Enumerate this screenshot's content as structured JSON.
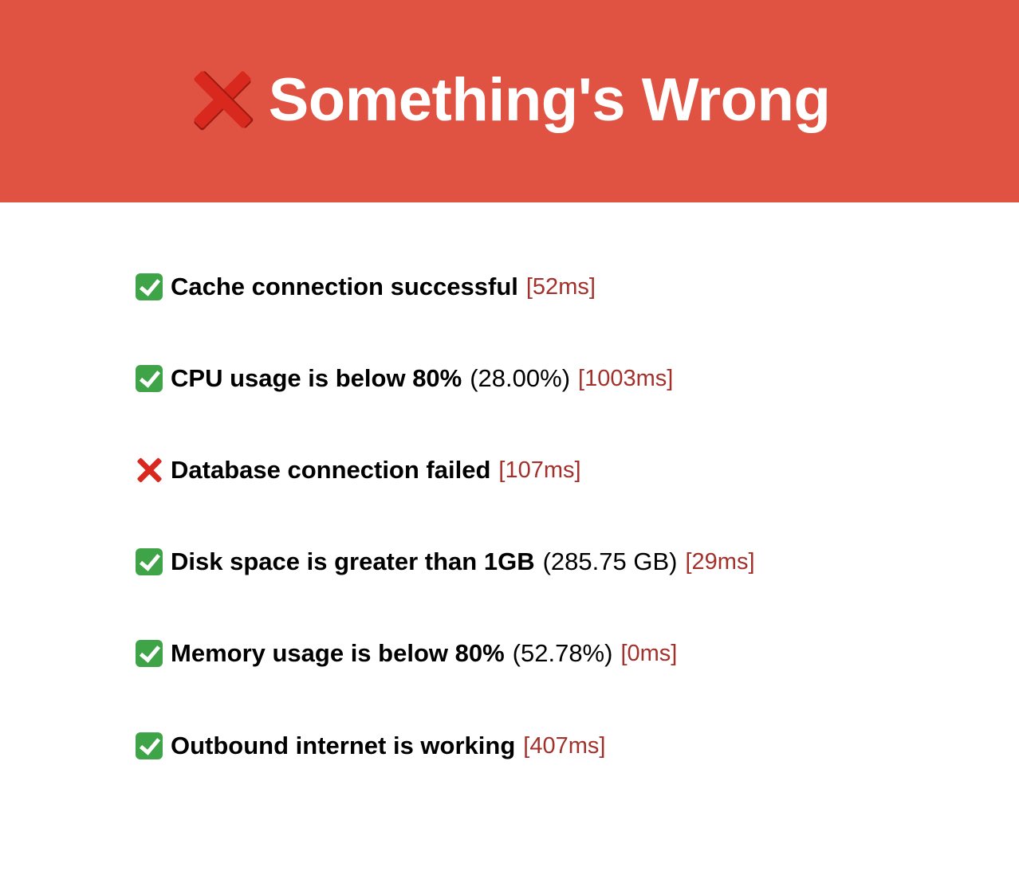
{
  "header": {
    "status_icon": "cross-mark-icon",
    "title": "Something's Wrong",
    "background_color": "#e05343"
  },
  "checks": [
    {
      "status": "pass",
      "icon": "check-mark-icon",
      "label": "Cache connection successful",
      "detail": "",
      "time": "[52ms]"
    },
    {
      "status": "pass",
      "icon": "check-mark-icon",
      "label": "CPU usage is below 80%",
      "detail": "(28.00%)",
      "time": "[1003ms]"
    },
    {
      "status": "fail",
      "icon": "cross-mark-icon",
      "label": "Database connection failed",
      "detail": "",
      "time": "[107ms]"
    },
    {
      "status": "pass",
      "icon": "check-mark-icon",
      "label": "Disk space is greater than 1GB",
      "detail": "(285.75 GB)",
      "time": "[29ms]"
    },
    {
      "status": "pass",
      "icon": "check-mark-icon",
      "label": "Memory usage is below 80%",
      "detail": "(52.78%)",
      "time": "[0ms]"
    },
    {
      "status": "pass",
      "icon": "check-mark-icon",
      "label": "Outbound internet is working",
      "detail": "",
      "time": "[407ms]"
    }
  ],
  "colors": {
    "pass": "#3fa447",
    "fail": "#d9281d",
    "time": "#a3302a"
  }
}
